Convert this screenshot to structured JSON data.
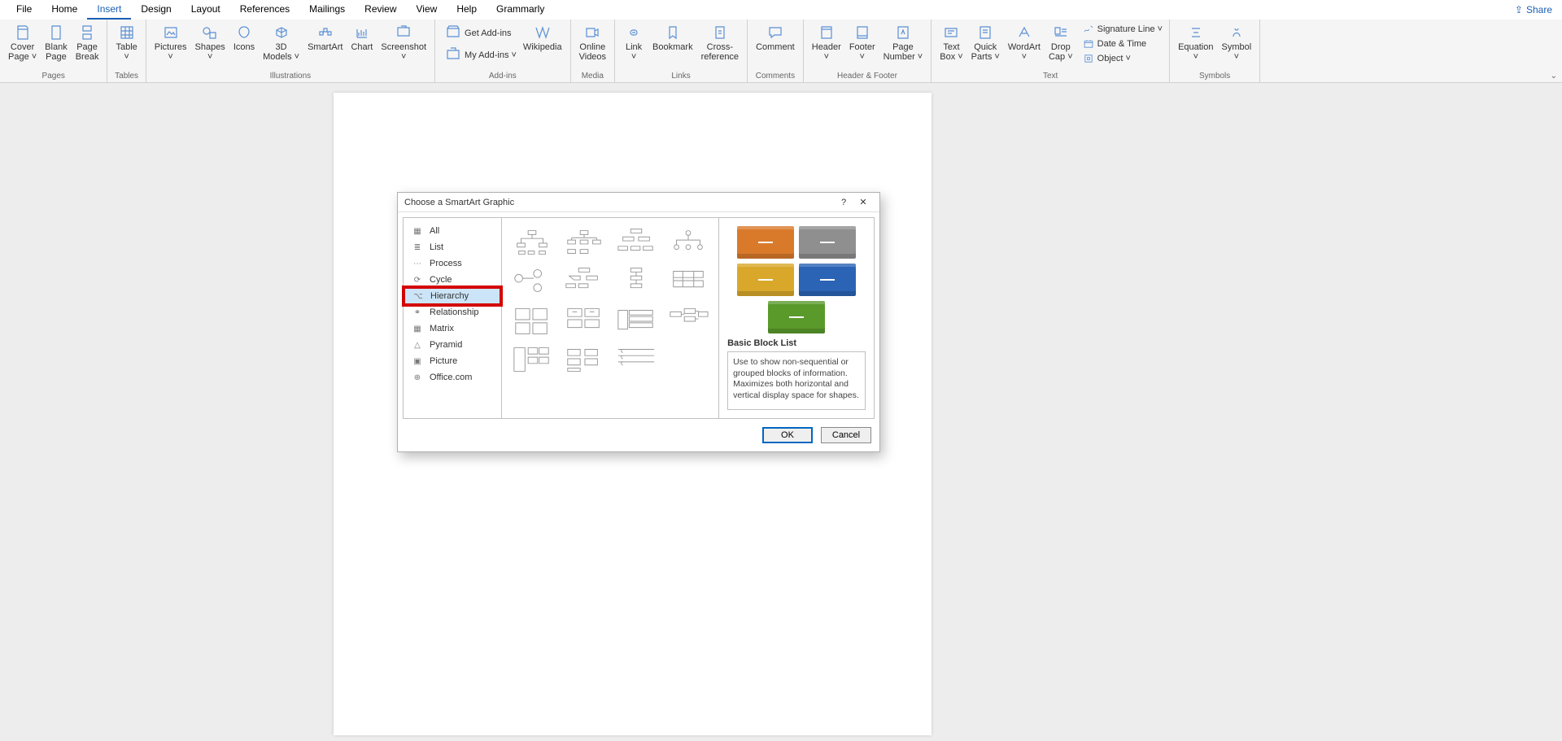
{
  "menu": {
    "tabs": [
      "File",
      "Home",
      "Insert",
      "Design",
      "Layout",
      "References",
      "Mailings",
      "Review",
      "View",
      "Help",
      "Grammarly"
    ],
    "active": "Insert",
    "share": "Share"
  },
  "ribbon": {
    "groups": [
      {
        "label": "Pages",
        "items": [
          {
            "l": "Cover\nPage ˅",
            "i": "cover"
          },
          {
            "l": "Blank\nPage",
            "i": "blank"
          },
          {
            "l": "Page\nBreak",
            "i": "break"
          }
        ]
      },
      {
        "label": "Tables",
        "items": [
          {
            "l": "Table\n˅",
            "i": "table"
          }
        ]
      },
      {
        "label": "Illustrations",
        "items": [
          {
            "l": "Pictures\n˅",
            "i": "pic"
          },
          {
            "l": "Shapes\n˅",
            "i": "shapes"
          },
          {
            "l": "Icons",
            "i": "icons"
          },
          {
            "l": "3D\nModels ˅",
            "i": "3d"
          },
          {
            "l": "SmartArt",
            "i": "smartart"
          },
          {
            "l": "Chart",
            "i": "chart"
          },
          {
            "l": "Screenshot\n˅",
            "i": "screenshot"
          }
        ]
      },
      {
        "label": "Add-ins",
        "inline": [
          {
            "l": "Get Add-ins",
            "i": "store"
          },
          {
            "l": "My Add-ins  ˅",
            "i": "myaddins"
          }
        ],
        "items": [
          {
            "l": "Wikipedia",
            "i": "wiki"
          }
        ]
      },
      {
        "label": "Media",
        "items": [
          {
            "l": "Online\nVideos",
            "i": "video"
          }
        ]
      },
      {
        "label": "Links",
        "items": [
          {
            "l": "Link\n˅",
            "i": "link"
          },
          {
            "l": "Bookmark",
            "i": "bookmark"
          },
          {
            "l": "Cross-\nreference",
            "i": "xref"
          }
        ]
      },
      {
        "label": "Comments",
        "items": [
          {
            "l": "Comment",
            "i": "comment"
          }
        ]
      },
      {
        "label": "Header & Footer",
        "items": [
          {
            "l": "Header\n˅",
            "i": "header"
          },
          {
            "l": "Footer\n˅",
            "i": "footer"
          },
          {
            "l": "Page\nNumber ˅",
            "i": "pagenum"
          }
        ]
      },
      {
        "label": "Text",
        "items": [
          {
            "l": "Text\nBox ˅",
            "i": "textbox"
          },
          {
            "l": "Quick\nParts ˅",
            "i": "quickparts"
          },
          {
            "l": "WordArt\n˅",
            "i": "wordart"
          },
          {
            "l": "Drop\nCap ˅",
            "i": "dropcap"
          }
        ],
        "inline": [
          {
            "l": "Signature Line  ˅",
            "i": "sig"
          },
          {
            "l": "Date & Time",
            "i": "datetime"
          },
          {
            "l": "Object  ˅",
            "i": "object"
          }
        ]
      },
      {
        "label": "Symbols",
        "items": [
          {
            "l": "Equation\n˅",
            "i": "eq"
          },
          {
            "l": "Symbol\n˅",
            "i": "sym"
          }
        ]
      }
    ]
  },
  "dialog": {
    "title": "Choose a SmartArt Graphic",
    "categories": [
      {
        "label": "All",
        "icon": "all"
      },
      {
        "label": "List",
        "icon": "list"
      },
      {
        "label": "Process",
        "icon": "process"
      },
      {
        "label": "Cycle",
        "icon": "cycle"
      },
      {
        "label": "Hierarchy",
        "icon": "hierarchy",
        "selected": true,
        "highlighted": true
      },
      {
        "label": "Relationship",
        "icon": "relationship"
      },
      {
        "label": "Matrix",
        "icon": "matrix"
      },
      {
        "label": "Pyramid",
        "icon": "pyramid"
      },
      {
        "label": "Picture",
        "icon": "picture"
      },
      {
        "label": "Office.com",
        "icon": "office"
      }
    ],
    "preview": {
      "name": "Basic Block List",
      "desc": "Use to show non-sequential or grouped blocks of information. Maximizes both horizontal and vertical display space for shapes.",
      "colors": [
        "#d97a2b",
        "#8f8f8f",
        "#d9a82b",
        "#2b63b5",
        "#5a9a2b"
      ]
    },
    "buttons": {
      "ok": "OK",
      "cancel": "Cancel"
    },
    "help": "?",
    "close": "✕"
  }
}
